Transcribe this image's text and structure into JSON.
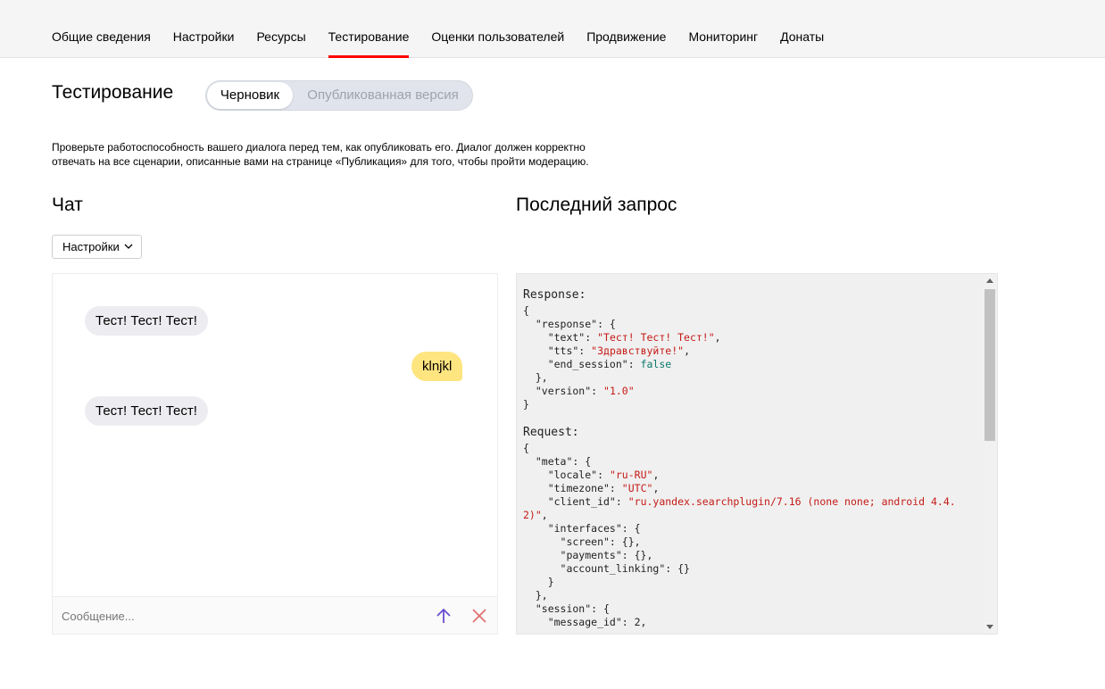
{
  "nav": {
    "tabs": [
      {
        "label": "Общие сведения"
      },
      {
        "label": "Настройки"
      },
      {
        "label": "Ресурсы"
      },
      {
        "label": "Тестирование"
      },
      {
        "label": "Оценки пользователей"
      },
      {
        "label": "Продвижение"
      },
      {
        "label": "Мониторинг"
      },
      {
        "label": "Донаты"
      }
    ],
    "active_tab": "Тестирование",
    "accent_color": "#ff0000"
  },
  "header": {
    "title": "Тестирование",
    "switch": {
      "draft": "Черновик",
      "published": "Опубликованная версия",
      "selected": "Черновик"
    }
  },
  "description": {
    "line1": "Проверьте работоспособность вашего диалога перед тем, как опубликовать его. Диалог должен корректно",
    "line2": "отвечать на все сценарии, описанные вами на странице «Публикация» для того, чтобы пройти модерацию."
  },
  "chat": {
    "title": "Чат",
    "settings_label": "Настройки",
    "messages": [
      {
        "from": "bot",
        "text": "Тест! Тест! Тест!"
      },
      {
        "from": "user",
        "text": "klnjkl"
      },
      {
        "from": "bot",
        "text": "Тест! Тест! Тест!"
      }
    ],
    "input_placeholder": "Сообщение...",
    "input_value": "",
    "send_icon": "arrow-up-icon",
    "clear_icon": "close-icon",
    "bot_bubble_color": "#ededf1",
    "user_bubble_color": "#ffe580"
  },
  "last_request": {
    "title": "Последний запрос",
    "response_label": "Response:",
    "request_label": "Request:",
    "response": {
      "text": "Тест! Тест! Тест!",
      "tts": "Здравствуйте!",
      "end_session": "false",
      "version": "1.0"
    },
    "request": {
      "locale": "ru-RU",
      "timezone": "UTC",
      "client_id_part1": "ru.yandex.searchplugin/7.16 (none none; android 4.4.",
      "client_id_part2": "2)"
    }
  }
}
